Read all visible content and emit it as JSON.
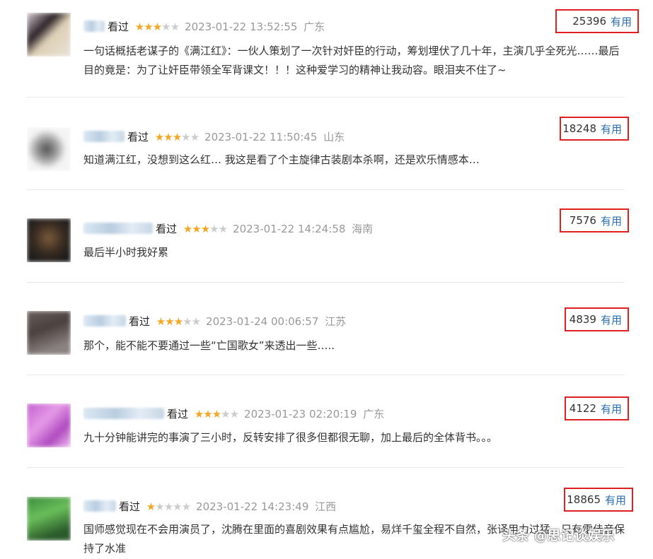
{
  "reviews": [
    {
      "watched": "看过",
      "stars": 3,
      "time": "2023-01-22 13:52:55",
      "location": "广东",
      "votes": "25396",
      "useful_label": "有用",
      "content": "一句话概括老谋子的《满江红》：一伙人策划了一次针对奸臣的行动，筹划埋伏了几十年，主演几乎全死光……最后目的竟是：为了让奸臣带领全军背课文！！！这种爱学习的精神让我动容。眼泪夹不住了~"
    },
    {
      "watched": "看过",
      "stars": 3,
      "time": "2023-01-22 11:50:45",
      "location": "山东",
      "votes": "18248",
      "useful_label": "有用",
      "content": "知道满江红，没想到这么红… 我这是看了个主旋律古装剧本杀啊，还是欢乐情感本…"
    },
    {
      "watched": "看过",
      "stars": 3,
      "time": "2023-01-22 14:24:58",
      "location": "海南",
      "votes": "7576",
      "useful_label": "有用",
      "content": "最后半小时我好累"
    },
    {
      "watched": "看过",
      "stars": 3,
      "time": "2023-01-24 00:06:57",
      "location": "江苏",
      "votes": "4839",
      "useful_label": "有用",
      "content": "那个，能不能不要通过一些“亡国歌女”来透出一些….."
    },
    {
      "watched": "看过",
      "stars": 3,
      "time": "2023-01-23 02:20:19",
      "location": "广东",
      "votes": "4122",
      "useful_label": "有用",
      "content": "九十分钟能讲完的事演了三小时，反转安排了很多但都很无聊，加上最后的全体背书。。。"
    },
    {
      "watched": "看过",
      "stars": 1,
      "time": "2023-01-22 14:23:49",
      "location": "江西",
      "votes": "18865",
      "useful_label": "有用",
      "content": "国师感觉现在不会用演员了，沈腾在里面的喜剧效果有点尴尬，易烊千玺全程不自然，张译用力过猛，只有雷佳音保持了水准"
    }
  ],
  "watermark": "头条 @思记谈娱乐",
  "colors": {
    "star": "#f5a623",
    "highlight_border": "#e02020",
    "useful_link": "#2a6fb0"
  }
}
